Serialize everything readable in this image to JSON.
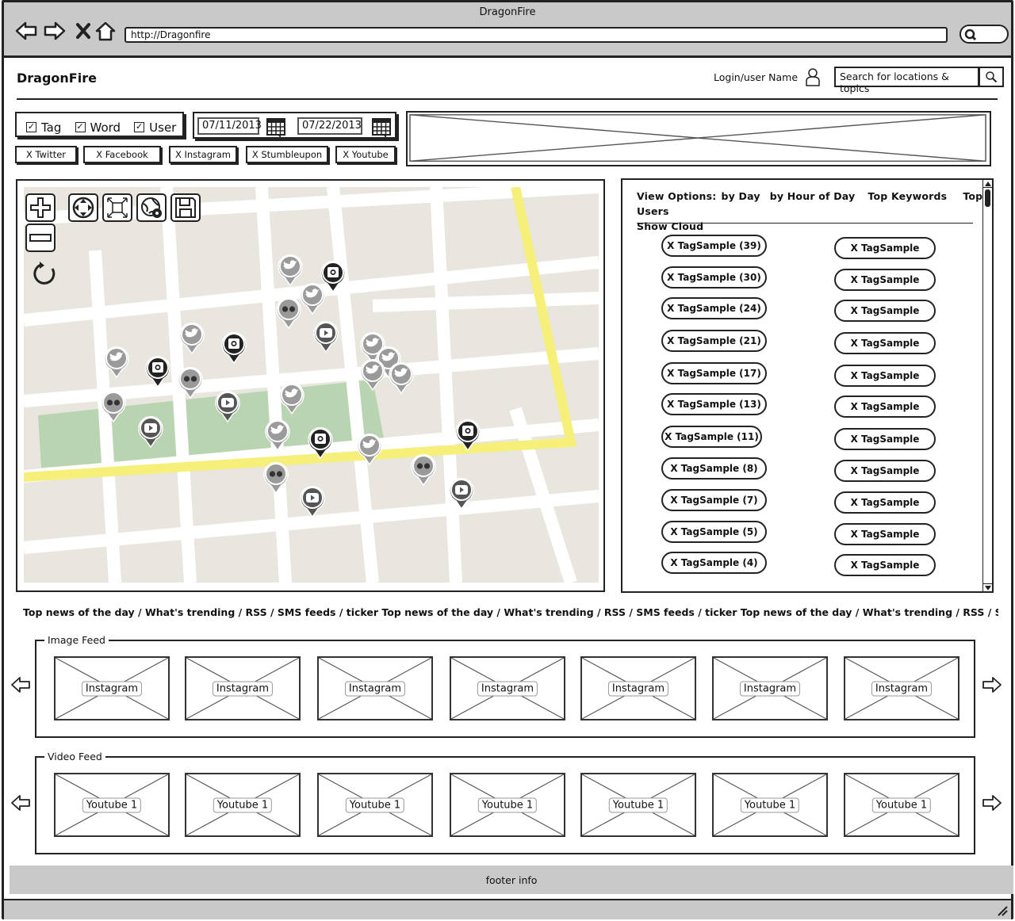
{
  "browser": {
    "title": "DragonFire",
    "url": "http://Dragonfire"
  },
  "header": {
    "logo": "DragonFire",
    "login_label": "Login/user Name",
    "search_placeholder": "Search for locations & topics"
  },
  "filters": {
    "checkboxes": [
      {
        "label": "Tag",
        "checked": true
      },
      {
        "label": "Word",
        "checked": true
      },
      {
        "label": "User",
        "checked": true
      }
    ],
    "date_from": "07/11/2013",
    "date_to": "07/22/2013",
    "sources": [
      "X Twitter",
      "X Facebook",
      "X Instagram",
      "X Stumbleupon",
      "X Youtube"
    ]
  },
  "tag_panel": {
    "view_label": "View Options:",
    "options": [
      "by Day",
      "by Hour of Day",
      "Top Keywords",
      "Top Users"
    ],
    "show_cloud": "Show Cloud",
    "left_tags": [
      "X TagSample  (39)",
      "X TagSample  (30)",
      "X TagSample  (24)",
      "X TagSample  (21)",
      "X TagSample  (17)",
      "X TagSample  (13)",
      "X TagSample  (11)",
      "X TagSample  (8)",
      "X TagSample  (7)",
      "X TagSample  (5)",
      "X TagSample  (4)"
    ],
    "right_tags": [
      "X TagSample",
      "X TagSample",
      "X TagSample",
      "X TagSample",
      "X TagSample",
      "X TagSample",
      "X TagSample",
      "X TagSample",
      "X TagSample",
      "X TagSample",
      "X TagSample"
    ]
  },
  "ticker": "Top news of the day / What's trending / RSS / SMS feeds / ticker   Top news of the day / What's trending / RSS / SMS feeds / ticker   Top news of the day / What's trending / RSS / SMS feeds /",
  "image_feed": {
    "title": "Image Feed",
    "items": [
      "Instagram",
      "Instagram",
      "Instagram",
      "Instagram",
      "Instagram",
      "Instagram",
      "Instagram"
    ]
  },
  "video_feed": {
    "title": "Video Feed",
    "items": [
      "Youtube 1",
      "Youtube 1",
      "Youtube 1",
      "Youtube 1",
      "Youtube 1",
      "Youtube 1",
      "Youtube 1"
    ]
  },
  "footer": "footer info",
  "map_pins": [
    {
      "kind": "twitter"
    },
    {
      "kind": "instagram"
    },
    {
      "kind": "twitter"
    },
    {
      "kind": "flickr"
    },
    {
      "kind": "youtube"
    },
    {
      "kind": "twitter"
    },
    {
      "kind": "instagram"
    },
    {
      "kind": "twitter"
    },
    {
      "kind": "instagram"
    },
    {
      "kind": "flickr"
    },
    {
      "kind": "flickr"
    },
    {
      "kind": "youtube"
    },
    {
      "kind": "youtube"
    },
    {
      "kind": "twitter"
    },
    {
      "kind": "twitter"
    },
    {
      "kind": "instagram"
    },
    {
      "kind": "twitter"
    },
    {
      "kind": "twitter"
    },
    {
      "kind": "twitter"
    },
    {
      "kind": "twitter"
    },
    {
      "kind": "twitter"
    },
    {
      "kind": "instagram"
    },
    {
      "kind": "flickr"
    },
    {
      "kind": "flickr"
    },
    {
      "kind": "youtube"
    },
    {
      "kind": "youtube"
    }
  ]
}
